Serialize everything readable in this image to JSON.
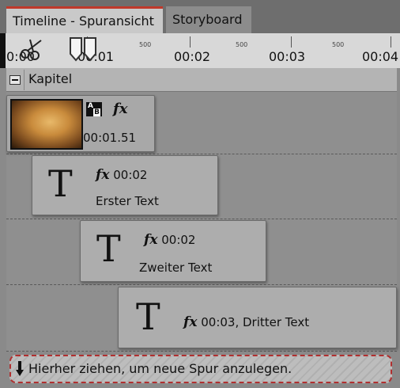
{
  "tabs": [
    {
      "label": "Timeline - Spuransicht",
      "active": true
    },
    {
      "label": "Storyboard",
      "active": false
    }
  ],
  "ruler": {
    "major_labels": [
      "0:00",
      "00:01",
      "00:02",
      "00:03",
      "00:04"
    ],
    "minor_label": "500"
  },
  "chapter": {
    "label": "Kapitel"
  },
  "clips": {
    "image": {
      "time": "00:01.51",
      "fx": "fx",
      "ab": [
        "A",
        "B"
      ]
    },
    "text1": {
      "time": "00:02",
      "name": "Erster Text",
      "glyph": "T",
      "fx": "fx"
    },
    "text2": {
      "time": "00:02",
      "name": "Zweiter Text",
      "glyph": "T",
      "fx": "fx"
    },
    "text3": {
      "time_and_name": "00:03, Dritter Text",
      "glyph": "T",
      "fx": "fx"
    }
  },
  "dropzone": {
    "label": "Hierher ziehen, um neue Spur anzulegen."
  },
  "colors": {
    "active_tab_accent": "#c0392b",
    "dropzone_border": "#b03030"
  }
}
